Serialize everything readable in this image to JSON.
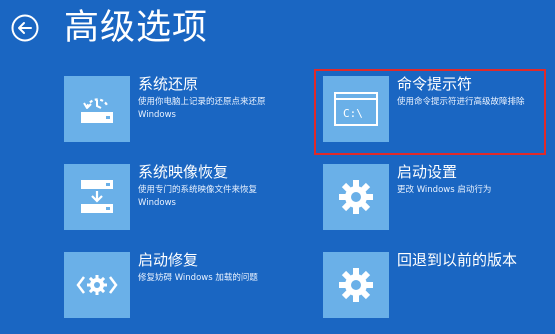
{
  "header": {
    "title": "高级选项"
  },
  "options": [
    {
      "title": "系统还原",
      "desc": "使用你电脑上记录的还原点来还原 Windows",
      "icon": "system-restore-icon"
    },
    {
      "title": "命令提示符",
      "desc": "使用命令提示符进行高级故障排除",
      "icon": "command-prompt-icon"
    },
    {
      "title": "系统映像恢复",
      "desc": "使用专门的系统映像文件来恢复 Windows",
      "icon": "system-image-icon"
    },
    {
      "title": "启动设置",
      "desc": "更改 Windows 启动行为",
      "icon": "gear-icon"
    },
    {
      "title": "启动修复",
      "desc": "修复妨碍 Windows 加载的问题",
      "icon": "startup-repair-icon"
    },
    {
      "title": "回退到以前的版本",
      "desc": "",
      "icon": "gear-icon"
    }
  ],
  "colors": {
    "background": "#1a66c2",
    "tile": "#6ab0e8",
    "highlight_border": "#e02a2a"
  },
  "cmd_tile_text": "C:\\"
}
